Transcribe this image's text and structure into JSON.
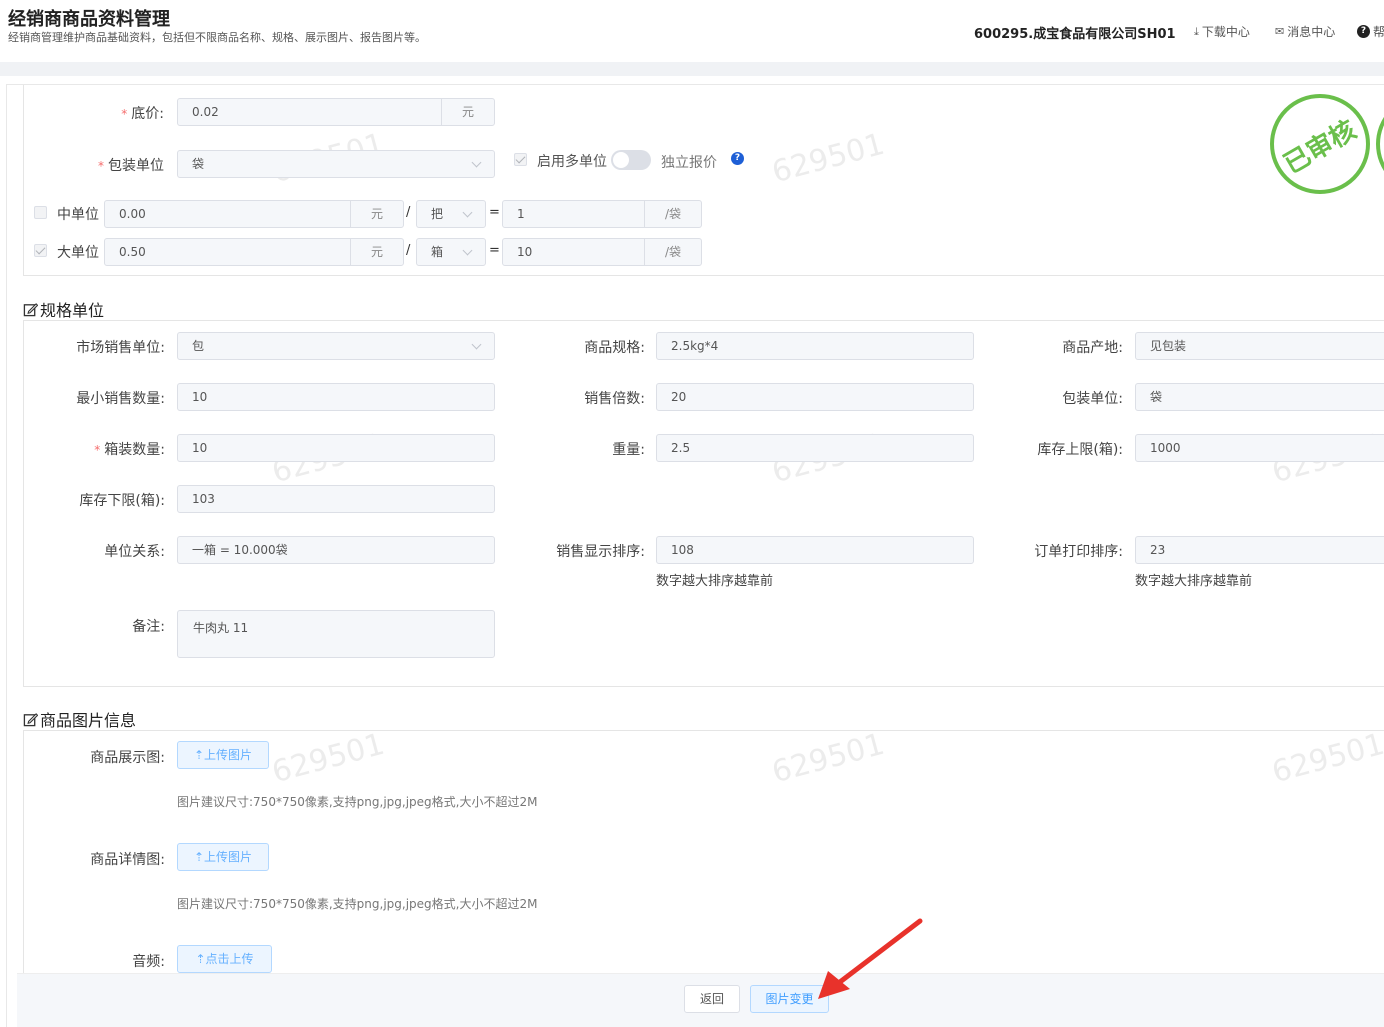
{
  "header": {
    "title": "经销商商品资料管理",
    "subtitle": "经销商管理维护商品基础资料，包括但不限商品名称、规格、展示图片、报告图片等。",
    "company": "600295.成宝食品有限公司SH01",
    "download": "下载中心",
    "messages": "消息中心",
    "help_partial": "帮"
  },
  "price": {
    "base_label": "底价:",
    "base_value": "0.02",
    "base_unit": "元",
    "pack_unit_label": "包装单位",
    "pack_unit_value": "袋",
    "multi_unit_label": "启用多单位",
    "independent_price_label": "独立报价",
    "mid_unit_label": "中单位",
    "mid_price": "0.00",
    "mid_currency": "元",
    "mid_unit": "把",
    "mid_qty": "1",
    "mid_per": "/袋",
    "big_unit_label": "大单位",
    "big_price": "0.50",
    "big_currency": "元",
    "big_unit": "箱",
    "big_qty": "10",
    "big_per": "/袋",
    "slash": "/",
    "equals": "="
  },
  "stamp": {
    "text": "已审核",
    "color": "#6abf4b"
  },
  "spec": {
    "title": "规格单位",
    "market_unit_label": "市场销售单位:",
    "market_unit_value": "包",
    "spec_label": "商品规格:",
    "spec_value": "2.5kg*4",
    "origin_label": "商品产地:",
    "origin_value": "见包装",
    "min_qty_label": "最小销售数量:",
    "min_qty_value": "10",
    "multiple_label": "销售倍数:",
    "multiple_value": "20",
    "pack_unit_label": "包装单位:",
    "pack_unit_value": "袋",
    "box_qty_label": "箱装数量:",
    "box_qty_value": "10",
    "weight_label": "重量:",
    "weight_value": "2.5",
    "stock_upper_label": "库存上限(箱):",
    "stock_upper_value": "1000",
    "stock_lower_label": "库存下限(箱):",
    "stock_lower_value": "103",
    "unit_relation_label": "单位关系:",
    "unit_relation_value": "一箱 = 10.000袋",
    "sale_sort_label": "销售显示排序:",
    "sale_sort_value": "108",
    "sale_sort_hint": "数字越大排序越靠前",
    "print_sort_label": "订单打印排序:",
    "print_sort_value": "23",
    "print_sort_hint": "数字越大排序越靠前",
    "remark_label": "备注:",
    "remark_value": "牛肉丸 11"
  },
  "images": {
    "title": "商品图片信息",
    "display_label": "商品展示图:",
    "display_btn": "上传图片",
    "display_hint": "图片建议尺寸:750*750像素,支持png,jpg,jpeg格式,大小不超过2M",
    "detail_label": "商品详情图:",
    "detail_btn": "上传图片",
    "detail_hint": "图片建议尺寸:750*750像素,支持png,jpg,jpeg格式,大小不超过2M",
    "audio_label": "音频:",
    "audio_btn": "点击上传"
  },
  "watermark": "629501",
  "footer": {
    "back": "返回",
    "image_change": "图片变更"
  },
  "accent_color": "#409eff",
  "arrow_color": "#e8322b"
}
